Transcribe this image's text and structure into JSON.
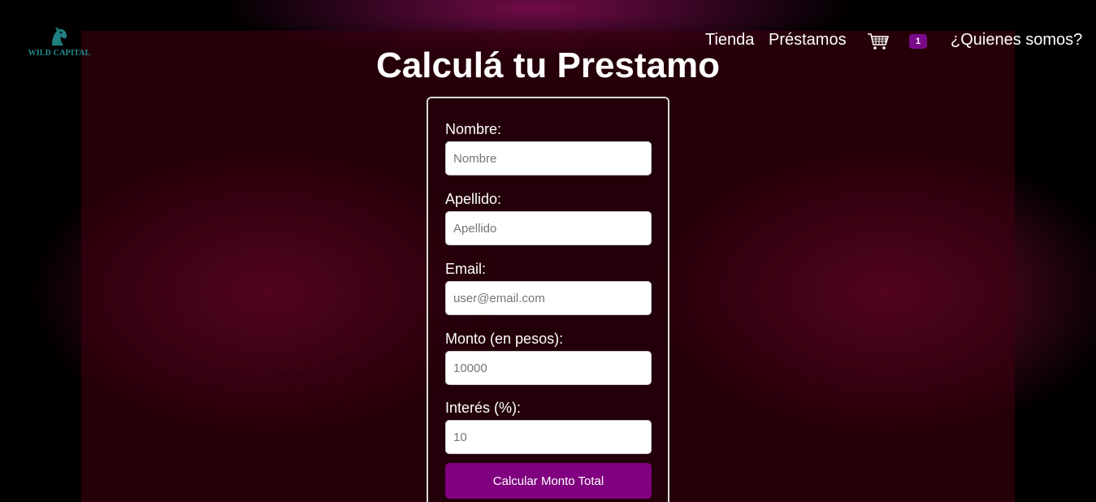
{
  "logo": {
    "text": "WILD CAPITAL",
    "icon": "horse-head-icon"
  },
  "nav": {
    "links": [
      "Tienda",
      "Préstamos",
      "¿Quienes somos?"
    ],
    "cart_icon": "shopping-cart-icon",
    "cart_count": "1"
  },
  "page": {
    "title": "Calculá tu Prestamo"
  },
  "form": {
    "nombre": {
      "label": "Nombre:",
      "placeholder": "Nombre"
    },
    "apellido": {
      "label": "Apellido:",
      "placeholder": "Apellido"
    },
    "email": {
      "label": "Email:",
      "placeholder": "user@email.com"
    },
    "monto": {
      "label": "Monto (en pesos):",
      "placeholder": "10000"
    },
    "interes": {
      "label": "Interés (%):",
      "placeholder": "10"
    },
    "submit_label": "Calcular Monto Total"
  },
  "colors": {
    "accent": "#800080",
    "badge": "#7a0a8a",
    "logo": "#1f8f8f",
    "background_pink": "#d61660"
  }
}
